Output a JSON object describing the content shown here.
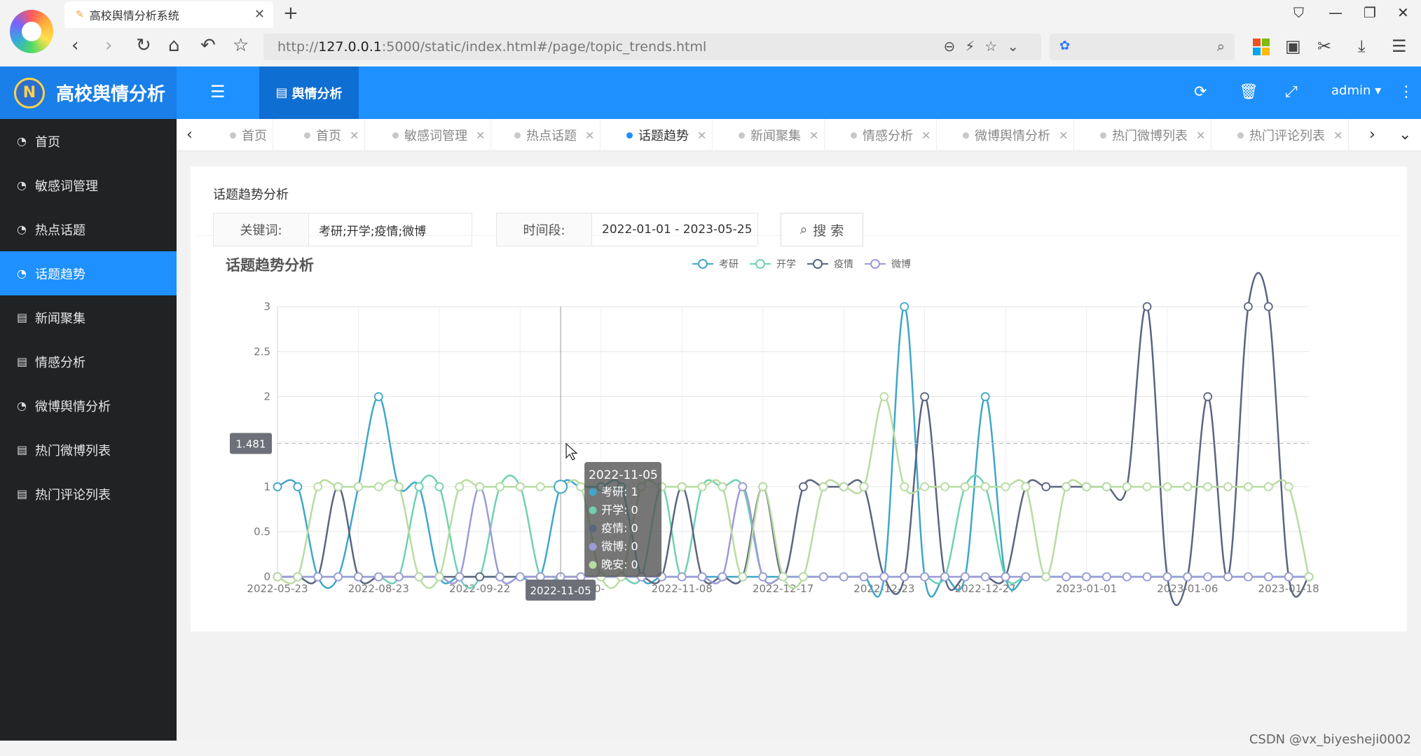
{
  "browser": {
    "tab_title": "高校舆情分析系统",
    "url_prefix": "http://",
    "url_host": "127.0.0.1",
    "url_rest": ":5000/static/index.html#/page/topic_trends.html"
  },
  "header": {
    "brand": "高校舆情分析",
    "module_tab": "舆情分析",
    "user": "admin"
  },
  "sidebar": {
    "items": [
      {
        "label": "首页",
        "icon": "dashboard-icon"
      },
      {
        "label": "敏感词管理",
        "icon": "dashboard-icon"
      },
      {
        "label": "热点话题",
        "icon": "dashboard-icon"
      },
      {
        "label": "话题趋势",
        "icon": "dashboard-icon",
        "active": true
      },
      {
        "label": "新闻聚集",
        "icon": "file-icon"
      },
      {
        "label": "情感分析",
        "icon": "file-icon"
      },
      {
        "label": "微博舆情分析",
        "icon": "dashboard-icon"
      },
      {
        "label": "热门微博列表",
        "icon": "file-icon"
      },
      {
        "label": "热门评论列表",
        "icon": "file-icon"
      }
    ]
  },
  "tabs": [
    {
      "label": "首页"
    },
    {
      "label": "首页"
    },
    {
      "label": "敏感词管理"
    },
    {
      "label": "热点话题"
    },
    {
      "label": "话题趋势",
      "active": true
    },
    {
      "label": "新闻聚集"
    },
    {
      "label": "情感分析"
    },
    {
      "label": "微博舆情分析"
    },
    {
      "label": "热门微博列表"
    },
    {
      "label": "热门评论列表"
    }
  ],
  "form": {
    "card_title": "话题趋势分析",
    "keyword_label": "关键词:",
    "keyword_value": "考研;开学;疫情;微博",
    "period_label": "时间段:",
    "period_value": "2022-01-01 - 2023-05-25",
    "search_label": "搜 索"
  },
  "watermark": "CSDN @vx_biyesheji0002",
  "chart_data": {
    "type": "line",
    "title": "话题趋势分析",
    "ylim": [
      0,
      3
    ],
    "yticks": [
      0,
      0.5,
      1,
      1.5,
      2,
      2.5,
      3
    ],
    "x_labels_shown": [
      "2022-05-23",
      "2022-08-23",
      "2022-09-22",
      "2022-10-",
      "2022-11-08",
      "2022-12-17",
      "2022-12-23",
      "2022-12-27",
      "2023-01-01",
      "2023-01-06",
      "2023-01-18"
    ],
    "series": [
      {
        "name": "考研",
        "color": "#3fa7c9",
        "values": [
          1,
          1,
          0,
          0,
          1,
          2,
          1,
          1,
          0,
          0,
          0,
          0,
          0,
          0,
          1,
          1,
          1,
          1,
          0,
          0,
          0,
          0,
          0,
          0,
          0,
          0,
          0,
          0,
          0,
          0,
          0,
          3,
          0,
          0,
          0,
          2,
          0,
          0,
          0,
          0,
          0,
          0,
          0,
          0,
          0,
          0,
          0,
          0,
          0,
          0,
          0,
          0
        ]
      },
      {
        "name": "开学",
        "color": "#6fd1b4",
        "values": [
          0,
          0,
          0,
          0,
          0,
          0,
          0,
          1,
          1,
          0,
          0,
          1,
          1,
          0,
          0,
          0,
          0,
          0,
          0,
          1,
          0,
          1,
          1,
          1,
          0,
          0,
          0,
          0,
          0,
          0,
          0,
          0,
          0,
          0,
          1,
          1,
          0,
          0,
          0,
          0,
          0,
          0,
          0,
          0,
          0,
          0,
          0,
          0,
          0,
          0,
          0,
          0
        ]
      },
      {
        "name": "疫情",
        "color": "#5a6580",
        "values": [
          0,
          0,
          0,
          1,
          0,
          0,
          0,
          0,
          0,
          0,
          0,
          0,
          0,
          0,
          0,
          0,
          0,
          0,
          0,
          0,
          1,
          0,
          0,
          0,
          1,
          0,
          1,
          1,
          1,
          1,
          0,
          0,
          2,
          0,
          0,
          0,
          0,
          1,
          1,
          1,
          1,
          1,
          1,
          3,
          0,
          0,
          2,
          0,
          3,
          3,
          0,
          0
        ]
      },
      {
        "name": "微博",
        "color": "#9b9bd6",
        "values": [
          0,
          0,
          0,
          0,
          0,
          0,
          0,
          0,
          0,
          0,
          1,
          0,
          0,
          0,
          0,
          0,
          0,
          0,
          0,
          0,
          0,
          0,
          0,
          1,
          0,
          0,
          0,
          0,
          0,
          0,
          0,
          0,
          0,
          0,
          0,
          0,
          0,
          0,
          0,
          0,
          0,
          0,
          0,
          0,
          0,
          0,
          0,
          0,
          0,
          0,
          0,
          0
        ]
      },
      {
        "name": "晚安",
        "color": "#b8dca0",
        "values": [
          0,
          0,
          1,
          1,
          1,
          1,
          1,
          0,
          0,
          1,
          1,
          1,
          1,
          1,
          1,
          1,
          0,
          0,
          1,
          1,
          1,
          1,
          1,
          0,
          1,
          0,
          0,
          1,
          1,
          1,
          2,
          1,
          1,
          1,
          1,
          1,
          1,
          1,
          0,
          1,
          1,
          1,
          1,
          1,
          1,
          1,
          1,
          1,
          1,
          1,
          1,
          0
        ]
      }
    ],
    "tooltip": {
      "date": "2022-11-05",
      "rows": [
        {
          "name": "考研",
          "value": 1,
          "color": "#3fa7c9"
        },
        {
          "name": "开学",
          "value": 0,
          "color": "#6fd1b4"
        },
        {
          "name": "疫情",
          "value": 0,
          "color": "#5a6580"
        },
        {
          "name": "微博",
          "value": 0,
          "color": "#9b9bd6"
        },
        {
          "name": "晚安",
          "value": 0,
          "color": "#b8dca0"
        }
      ]
    },
    "hover_index": 14,
    "y_pointer_value": "1.481",
    "legend_position": "top-center",
    "legend_series": [
      "考研",
      "开学",
      "疫情",
      "微博"
    ],
    "grid": true
  }
}
